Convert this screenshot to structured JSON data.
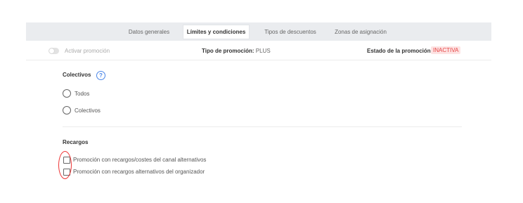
{
  "tabs": [
    {
      "label": "Datos generales",
      "active": false
    },
    {
      "label": "Límites y condiciones",
      "active": true
    },
    {
      "label": "Tipos de descuentos",
      "active": false
    },
    {
      "label": "Zonas de asignación",
      "active": false
    }
  ],
  "info_row": {
    "toggle_label": "Activar promoción",
    "toggle_on": false,
    "promo_type_label": "Tipo de promoción:",
    "promo_type_value": "PLUS",
    "promo_state_label": "Estado de la promoción:",
    "promo_state_value": "INACTIVA"
  },
  "colectivos": {
    "title": "Colectivos",
    "help_icon": "question-circle-icon",
    "options": [
      "Todos",
      "Colectivos"
    ]
  },
  "recargos": {
    "title": "Recargos",
    "options": [
      "Promoción con recargos/costes del canal alternativos",
      "Promoción con recargos alternativos del organizador"
    ]
  },
  "colors": {
    "tabs_background": "#eaecef",
    "badge_background": "#fde3e3",
    "badge_text": "#e64646",
    "help_icon": "#4a86e8",
    "annotation": "#ee3333"
  }
}
